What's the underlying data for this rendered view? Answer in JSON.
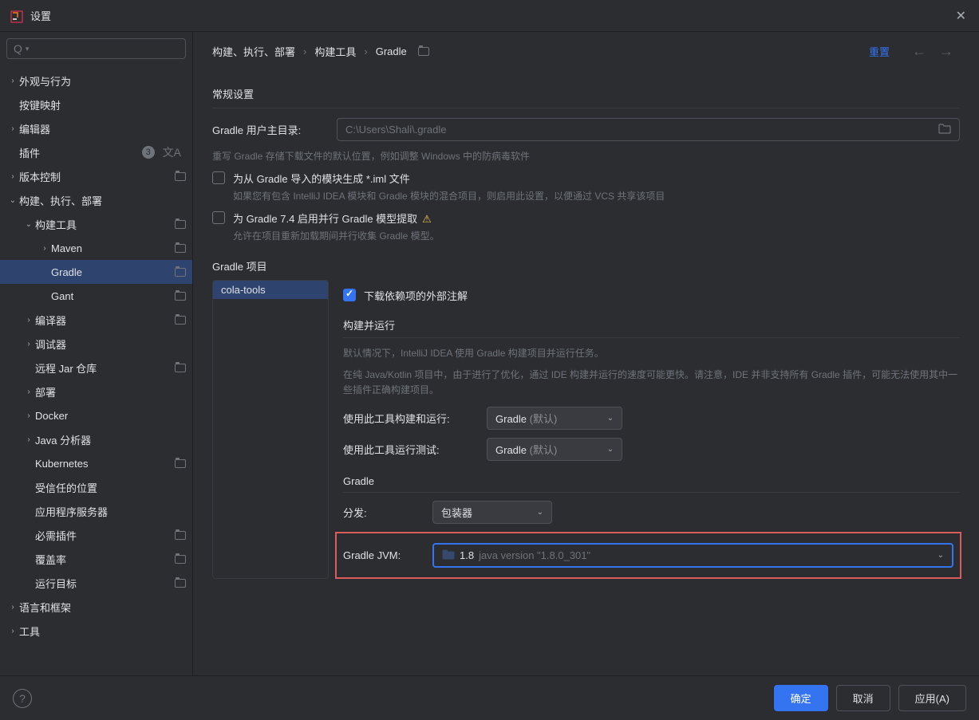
{
  "window": {
    "title": "设置"
  },
  "search": {
    "placeholder": ""
  },
  "sidebar": {
    "items": [
      {
        "label": "外观与行为",
        "arrow": "›",
        "indent": 0,
        "proj": false
      },
      {
        "label": "按键映射",
        "arrow": "",
        "indent": 0,
        "proj": false
      },
      {
        "label": "编辑器",
        "arrow": "›",
        "indent": 0,
        "proj": false
      },
      {
        "label": "插件",
        "arrow": "",
        "indent": 0,
        "proj": false,
        "badge": "3",
        "lang": true
      },
      {
        "label": "版本控制",
        "arrow": "›",
        "indent": 0,
        "proj": true
      },
      {
        "label": "构建、执行、部署",
        "arrow": "⌄",
        "indent": 0,
        "proj": false
      },
      {
        "label": "构建工具",
        "arrow": "⌄",
        "indent": 1,
        "proj": true
      },
      {
        "label": "Maven",
        "arrow": "›",
        "indent": 2,
        "proj": true
      },
      {
        "label": "Gradle",
        "arrow": "",
        "indent": 2,
        "proj": true,
        "selected": true
      },
      {
        "label": "Gant",
        "arrow": "",
        "indent": 2,
        "proj": true
      },
      {
        "label": "编译器",
        "arrow": "›",
        "indent": 1,
        "proj": true
      },
      {
        "label": "调试器",
        "arrow": "›",
        "indent": 1,
        "proj": false
      },
      {
        "label": "远程 Jar 仓库",
        "arrow": "",
        "indent": 1,
        "proj": true
      },
      {
        "label": "部署",
        "arrow": "›",
        "indent": 1,
        "proj": false
      },
      {
        "label": "Docker",
        "arrow": "›",
        "indent": 1,
        "proj": false
      },
      {
        "label": "Java 分析器",
        "arrow": "›",
        "indent": 1,
        "proj": false
      },
      {
        "label": "Kubernetes",
        "arrow": "",
        "indent": 1,
        "proj": true
      },
      {
        "label": "受信任的位置",
        "arrow": "",
        "indent": 1,
        "proj": false
      },
      {
        "label": "应用程序服务器",
        "arrow": "",
        "indent": 1,
        "proj": false
      },
      {
        "label": "必需插件",
        "arrow": "",
        "indent": 1,
        "proj": true
      },
      {
        "label": "覆盖率",
        "arrow": "",
        "indent": 1,
        "proj": true
      },
      {
        "label": "运行目标",
        "arrow": "",
        "indent": 1,
        "proj": true
      },
      {
        "label": "语言和框架",
        "arrow": "›",
        "indent": 0,
        "proj": false
      },
      {
        "label": "工具",
        "arrow": "›",
        "indent": 0,
        "proj": false
      }
    ]
  },
  "breadcrumb": {
    "parts": [
      "构建、执行、部署",
      "构建工具",
      "Gradle"
    ],
    "reset": "重置"
  },
  "general": {
    "title": "常规设置",
    "userHomeLabel": "Gradle 用户主目录:",
    "userHomePlaceholder": "C:\\Users\\Shali\\.gradle",
    "userHomeHint": "重写 Gradle 存储下载文件的默认位置，例如调整 Windows 中的防病毒软件",
    "generateIml": "为从 Gradle 导入的模块生成 *.iml 文件",
    "generateImlHint": "如果您有包含 IntelliJ IDEA 模块和 Gradle 模块的混合项目，则启用此设置，以便通过 VCS 共享该项目",
    "parallelModel": "为 Gradle 7.4 启用并行 Gradle 模型提取",
    "parallelModelHint": "允许在项目重新加载期间并行收集 Gradle 模型。"
  },
  "projects": {
    "title": "Gradle 项目",
    "list": [
      "cola-tools"
    ],
    "downloadAnnotations": "下载依赖项的外部注解",
    "buildRunTitle": "构建并运行",
    "buildRunDesc1": "默认情况下，IntelliJ IDEA 使用 Gradle 构建项目并运行任务。",
    "buildRunDesc2": "在纯 Java/Kotlin 项目中，由于进行了优化，通过 IDE 构建并运行的速度可能更快。请注意，IDE 并非支持所有 Gradle 插件，可能无法使用其中一些插件正确构建项目。",
    "buildWithLabel": "使用此工具构建和运行:",
    "buildWithValue": "Gradle",
    "buildWithDefault": "(默认)",
    "testWithLabel": "使用此工具运行测试:",
    "testWithValue": "Gradle",
    "testWithDefault": "(默认)",
    "gradleSection": "Gradle",
    "distLabel": "分发:",
    "distValue": "包装器",
    "jvmLabel": "Gradle JVM:",
    "jvmVersion": "1.8",
    "jvmPath": "java version \"1.8.0_301\""
  },
  "footer": {
    "ok": "确定",
    "cancel": "取消",
    "apply": "应用(A)"
  }
}
